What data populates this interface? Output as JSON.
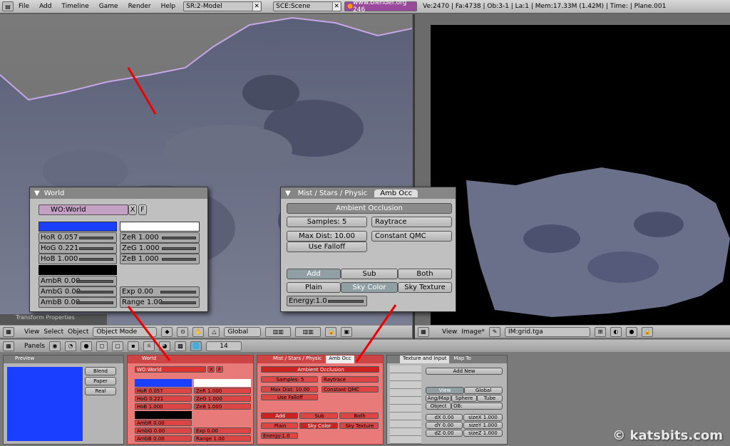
{
  "topbar": {
    "menus": [
      "File",
      "Add",
      "Timeline",
      "Game",
      "Render",
      "Help"
    ],
    "screen": "SR:2-Model",
    "scene": "SCE:Scene",
    "url": "www.blender.org 246",
    "stats": "Ve:2470 | Fa:4738 | Ob:3-1 | La:1 | Mem:17.33M (1.42M) | Time: | Plane.001"
  },
  "left_header": {
    "panel_label": "Transform Properties",
    "menus": [
      "View",
      "Select",
      "Object"
    ],
    "mode": "Object Mode",
    "orientation": "Global"
  },
  "right_header": {
    "menus": [
      "View",
      "Image*"
    ],
    "image_name": "IM:grid.tga"
  },
  "buttons_header": {
    "panels_label": "Panels",
    "frame": "14"
  },
  "world_panel": {
    "title": "World",
    "wo_name": "WO:World",
    "x_label": "X",
    "f_label": "F",
    "hor": "HoR 0.057",
    "hog": "HoG 0.221",
    "hob": "HoB 1.000",
    "zer": "ZeR 1.000",
    "zeg": "ZeG 1.000",
    "zeb": "ZeB 1.000",
    "ambr": "AmbR 0.00",
    "ambg": "AmbG 0.00",
    "ambb": "AmbB 0.00",
    "exp": "Exp 0.00",
    "range": "Range 1.00",
    "horizon_color": "#1a3fff",
    "zenith_color": "#ffffff"
  },
  "ao_panel": {
    "tab_mist": "Mist / Stars / Physic",
    "tab_amb": "Amb Occ",
    "header": "Ambient Occlusion",
    "samples": "Samples: 5",
    "raytrace": "Raytrace",
    "max_dist": "Max Dist: 10.00",
    "qmc": "Constant QMC",
    "use_falloff": "Use Falloff",
    "add": "Add",
    "sub": "Sub",
    "both": "Both",
    "plain": "Plain",
    "sky_color": "Sky Color",
    "sky_texture": "Sky Texture",
    "energy": "Energy:1.0"
  },
  "bottom": {
    "preview_title": "Preview",
    "blend": "Blend",
    "paper": "Paper",
    "real": "Real",
    "world_title": "World",
    "wo_name": "WO:World",
    "ao_tab_mist": "Mist / Stars / Physic",
    "ao_tab_amb": "Amb Occ",
    "ao_header": "Ambient Occlusion",
    "samples": "Samples: 5",
    "raytrace": "Raytrace",
    "max_dist": "Max Dist: 10.00",
    "qmc": "Constant QMC",
    "use_falloff": "Use Falloff",
    "add": "Add",
    "sub": "Sub",
    "both": "Both",
    "plain": "Plain",
    "sky_color": "Sky Color",
    "sky_texture": "Sky Texture",
    "energy": "Energy:1.0",
    "tex_tab1": "Texture and Input",
    "tex_tab2": "Map To",
    "add_new": "Add New",
    "view": "View",
    "global": "Global",
    "angmap": "Ang/Map",
    "sphere": "Sphere",
    "tube": "Tube",
    "object": "Object",
    "ob": "OB:",
    "dx": "dX 0.00",
    "dy": "dY 0.00",
    "dz": "dZ 0.00",
    "sizex": "sizeX 1.000",
    "sizey": "sizeY 1.000",
    "sizez": "sizeZ 1.000"
  },
  "watermark": "© katsbits.com"
}
